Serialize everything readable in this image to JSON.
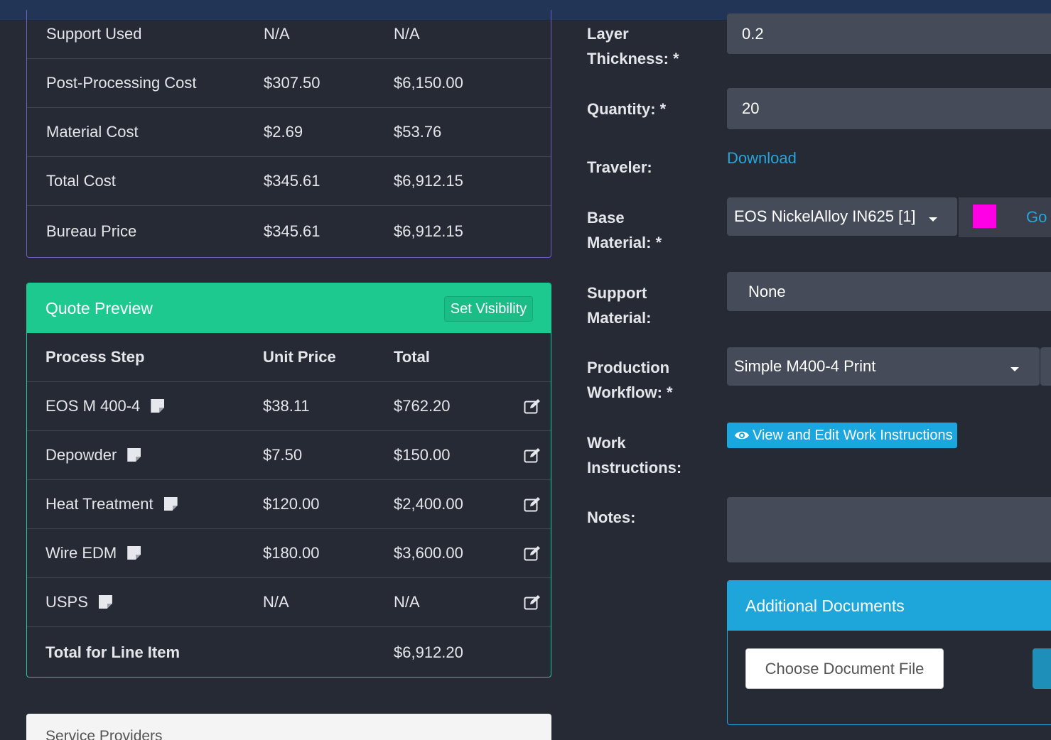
{
  "cost_table": {
    "rows": [
      {
        "label": "Support Used",
        "unit": "N/A",
        "total": "N/A"
      },
      {
        "label": "Post-Processing Cost",
        "unit": "$307.50",
        "total": "$6,150.00"
      },
      {
        "label": "Material Cost",
        "unit": "$2.69",
        "total": "$53.76"
      },
      {
        "label": "Total Cost",
        "unit": "$345.61",
        "total": "$6,912.15"
      },
      {
        "label": "Bureau Price",
        "unit": "$345.61",
        "total": "$6,912.15"
      }
    ]
  },
  "quote_preview": {
    "title": "Quote Preview",
    "set_visibility_label": "Set Visibility",
    "headers": {
      "step": "Process Step",
      "unit": "Unit Price",
      "total": "Total"
    },
    "rows": [
      {
        "step": "EOS M 400-4",
        "unit": "$38.11",
        "total": "$762.20"
      },
      {
        "step": "Depowder",
        "unit": "$7.50",
        "total": "$150.00"
      },
      {
        "step": "Heat Treatment",
        "unit": "$120.00",
        "total": "$2,400.00"
      },
      {
        "step": "Wire EDM",
        "unit": "$180.00",
        "total": "$3,600.00"
      },
      {
        "step": "USPS",
        "unit": "N/A",
        "total": "N/A"
      }
    ],
    "footer": {
      "label": "Total for Line Item",
      "total": "$6,912.20"
    }
  },
  "service_providers": {
    "title": "Service Providers"
  },
  "form": {
    "layer_thickness": {
      "label_line1": "Layer",
      "label_line2": "Thickness: *",
      "value": "0.2"
    },
    "quantity": {
      "label": "Quantity: *",
      "value": "20"
    },
    "traveler": {
      "label": "Traveler:",
      "link": "Download"
    },
    "base_material": {
      "label_line1": "Base",
      "label_line2": "Material: *",
      "value": "EOS NickelAlloy IN625 [1]",
      "color": "#ff00e6",
      "go_label": "Go"
    },
    "support_material": {
      "label_line1": "Support",
      "label_line2": "Material:",
      "value": "None"
    },
    "production_workflow": {
      "label_line1": "Production",
      "label_line2": "Workflow: *",
      "value": "Simple M400-4 Print"
    },
    "work_instructions": {
      "label_line1": "Work",
      "label_line2": "Instructions:",
      "button": "View and Edit Work Instructions"
    },
    "notes": {
      "label": "Notes:",
      "value": ""
    }
  },
  "additional_documents": {
    "title": "Additional Documents",
    "choose_label": "Choose Document File"
  },
  "colors": {
    "accent_green": "#1ec990",
    "accent_blue": "#1ea5da",
    "link": "#26a6dc",
    "background": "#262a34"
  }
}
